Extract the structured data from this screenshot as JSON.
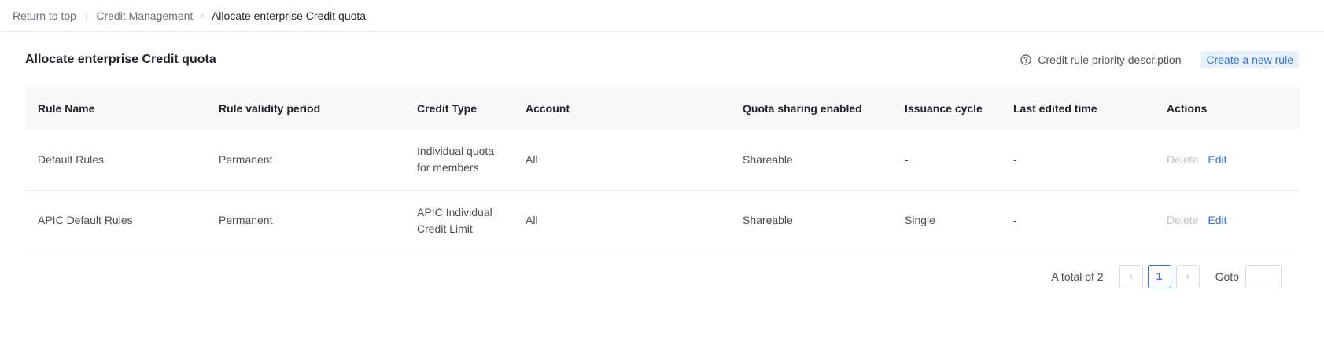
{
  "breadcrumb": {
    "back": "Return to top",
    "parent": "Credit Management",
    "current": "Allocate enterprise Credit quota"
  },
  "header": {
    "title": "Allocate enterprise Credit quota",
    "priority_link": "Credit rule priority description",
    "create_button": "Create a new rule"
  },
  "table": {
    "columns": [
      "Rule Name",
      "Rule validity period",
      "Credit Type",
      "Account",
      "Quota sharing enabled",
      "Issuance cycle",
      "Last edited time",
      "Actions"
    ],
    "rows": [
      {
        "name": "Default Rules",
        "validity": "Permanent",
        "credit_type": "Individual quota for members",
        "account": "All",
        "sharing": "Shareable",
        "cycle": "-",
        "edited": "-",
        "delete": "Delete",
        "edit": "Edit"
      },
      {
        "name": "APIC Default Rules",
        "validity": "Permanent",
        "credit_type": "APIC Individual Credit Limit",
        "account": "All",
        "sharing": "Shareable",
        "cycle": "Single",
        "edited": "-",
        "delete": "Delete",
        "edit": "Edit"
      }
    ]
  },
  "pagination": {
    "total": "A total of 2",
    "prev": "‹",
    "current_page": "1",
    "next": "›",
    "goto_label": "Goto",
    "goto_value": ""
  },
  "icons": {
    "help": "question-circle-icon"
  },
  "colors": {
    "accent": "#2b73e6",
    "accent_bg": "#e8f1fe",
    "disabled": "#c0c3c8"
  }
}
